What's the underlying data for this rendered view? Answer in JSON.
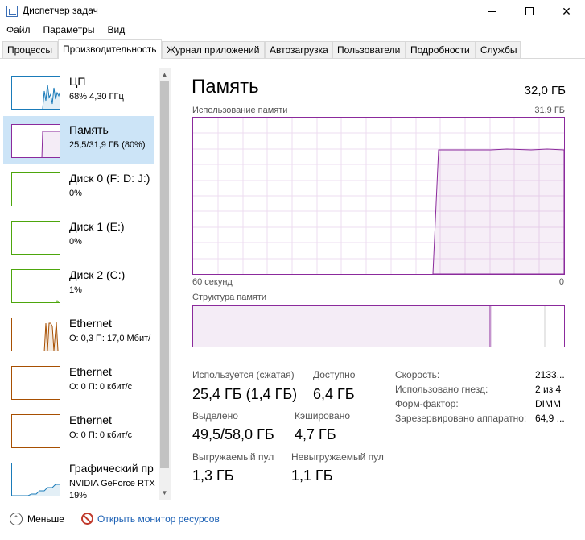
{
  "window": {
    "title": "Диспетчер задач",
    "minimize_icon": "minimize-icon",
    "maximize_icon": "maximize-icon",
    "close_icon": "close-icon"
  },
  "menu": [
    "Файл",
    "Параметры",
    "Вид"
  ],
  "tabs": [
    {
      "label": "Процессы",
      "active": false
    },
    {
      "label": "Производительность",
      "active": true
    },
    {
      "label": "Журнал приложений",
      "active": false
    },
    {
      "label": "Автозагрузка",
      "active": false
    },
    {
      "label": "Пользователи",
      "active": false
    },
    {
      "label": "Подробности",
      "active": false
    },
    {
      "label": "Службы",
      "active": false
    }
  ],
  "sidebar": {
    "items": [
      {
        "name": "ЦП",
        "sub": "68% 4,30 ГГц",
        "color": "#1a7bb9",
        "selected": false
      },
      {
        "name": "Память",
        "sub": "25,5/31,9 ГБ (80%)",
        "color": "#8b2a9c",
        "selected": true
      },
      {
        "name": "Диск 0 (F: D: J:)",
        "sub": "0%",
        "color": "#4da60c",
        "selected": false
      },
      {
        "name": "Диск 1 (E:)",
        "sub": "0%",
        "color": "#4da60c",
        "selected": false
      },
      {
        "name": "Диск 2 (C:)",
        "sub": "1%",
        "color": "#4da60c",
        "selected": false
      },
      {
        "name": "Ethernet",
        "sub": "О: 0,3 П: 17,0 Мбит/",
        "color": "#a74f01",
        "selected": false
      },
      {
        "name": "Ethernet",
        "sub": "О: 0 П: 0 кбит/с",
        "color": "#a74f01",
        "selected": false
      },
      {
        "name": "Ethernet",
        "sub": "О: 0 П: 0 кбит/с",
        "color": "#a74f01",
        "selected": false
      },
      {
        "name": "Графический пр",
        "sub": "NVIDIA GeForce RTX",
        "sub2": "19%",
        "color": "#1a7bb9",
        "selected": false
      }
    ]
  },
  "main": {
    "title": "Память",
    "total": "32,0 ГБ",
    "usage_label": "Использование памяти",
    "usage_max": "31,9 ГБ",
    "axis_left": "60 секунд",
    "axis_right": "0",
    "structure_label": "Структура памяти",
    "accent_color": "#8b2a9c"
  },
  "stats": {
    "in_use_label": "Используется (сжатая)",
    "in_use_value": "25,4 ГБ (1,4 ГБ)",
    "available_label": "Доступно",
    "available_value": "6,4 ГБ",
    "committed_label": "Выделено",
    "committed_value": "49,5/58,0 ГБ",
    "cached_label": "Кэшировано",
    "cached_value": "4,7 ГБ",
    "paged_label": "Выгружаемый пул",
    "paged_value": "1,3 ГБ",
    "nonpaged_label": "Невыгружаемый пул",
    "nonpaged_value": "1,1 ГБ"
  },
  "specs": [
    {
      "label": "Скорость:",
      "value": "2133..."
    },
    {
      "label": "Использовано гнезд:",
      "value": "2 из 4"
    },
    {
      "label": "Форм-фактор:",
      "value": "DIMM"
    },
    {
      "label": "Зарезервировано аппаратно:",
      "value": "64,9 ..."
    }
  ],
  "footer": {
    "less_label": "Меньше",
    "resmon_label": "Открыть монитор ресурсов"
  }
}
